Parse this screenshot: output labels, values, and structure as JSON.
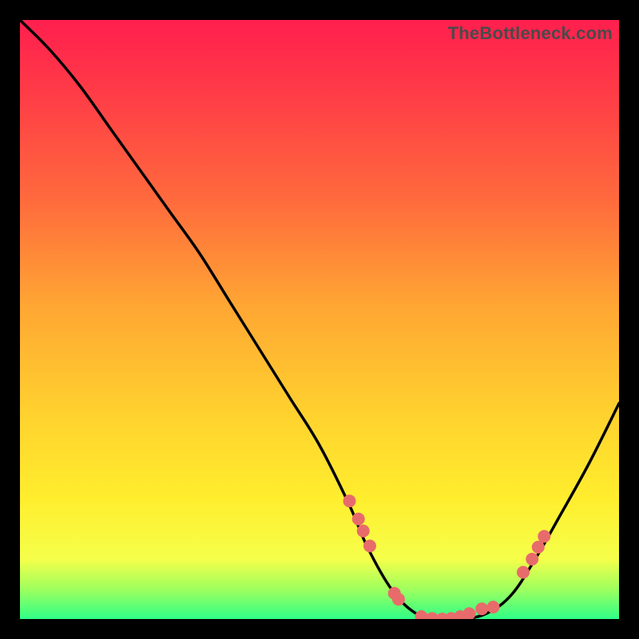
{
  "watermark": "TheBottleneck.com",
  "chart_data": {
    "type": "line",
    "title": "",
    "xlabel": "",
    "ylabel": "",
    "xlim": [
      0,
      100
    ],
    "ylim": [
      0,
      100
    ],
    "series": [
      {
        "name": "bottleneck-curve",
        "x": [
          0,
          5,
          10,
          15,
          20,
          25,
          30,
          35,
          40,
          45,
          50,
          55,
          58,
          62,
          66,
          70,
          74,
          78,
          82,
          86,
          90,
          95,
          100
        ],
        "values": [
          100,
          95,
          89,
          82,
          75,
          68,
          61,
          53,
          45,
          37,
          29,
          19,
          12,
          5,
          1,
          0,
          0,
          1,
          4,
          10,
          17,
          26,
          36
        ]
      }
    ],
    "annotations": [
      {
        "name": "marker-left-1",
        "x": 55.0,
        "y": 19.7
      },
      {
        "name": "marker-left-2",
        "x": 56.5,
        "y": 16.7
      },
      {
        "name": "marker-left-3",
        "x": 57.3,
        "y": 14.7
      },
      {
        "name": "marker-left-4",
        "x": 58.4,
        "y": 12.2
      },
      {
        "name": "marker-lowmid-1",
        "x": 62.5,
        "y": 4.3
      },
      {
        "name": "marker-lowmid-2",
        "x": 63.2,
        "y": 3.3
      },
      {
        "name": "marker-min-1",
        "x": 67.0,
        "y": 0.4
      },
      {
        "name": "marker-min-2",
        "x": 68.8,
        "y": 0.1
      },
      {
        "name": "marker-min-3",
        "x": 70.5,
        "y": 0.0
      },
      {
        "name": "marker-min-4",
        "x": 72.0,
        "y": 0.1
      },
      {
        "name": "marker-min-5",
        "x": 73.5,
        "y": 0.4
      },
      {
        "name": "marker-min-6",
        "x": 75.0,
        "y": 0.9
      },
      {
        "name": "marker-min-7",
        "x": 77.1,
        "y": 1.7
      },
      {
        "name": "marker-min-8",
        "x": 79.0,
        "y": 2.0
      },
      {
        "name": "marker-right-1",
        "x": 84.0,
        "y": 7.8
      },
      {
        "name": "marker-right-2",
        "x": 85.5,
        "y": 10.0
      },
      {
        "name": "marker-right-3",
        "x": 86.5,
        "y": 12.0
      },
      {
        "name": "marker-right-4",
        "x": 87.5,
        "y": 13.8
      }
    ],
    "gradient_stops": [
      {
        "pos": 0.0,
        "color": "#ff1f4e"
      },
      {
        "pos": 0.12,
        "color": "#ff3b47"
      },
      {
        "pos": 0.3,
        "color": "#ff6a3d"
      },
      {
        "pos": 0.48,
        "color": "#ffa733"
      },
      {
        "pos": 0.66,
        "color": "#ffd22e"
      },
      {
        "pos": 0.8,
        "color": "#ffee2e"
      },
      {
        "pos": 0.9,
        "color": "#f5ff4a"
      },
      {
        "pos": 0.95,
        "color": "#9fff5e"
      },
      {
        "pos": 1.0,
        "color": "#2eff87"
      }
    ],
    "grid": false,
    "legend": false
  }
}
